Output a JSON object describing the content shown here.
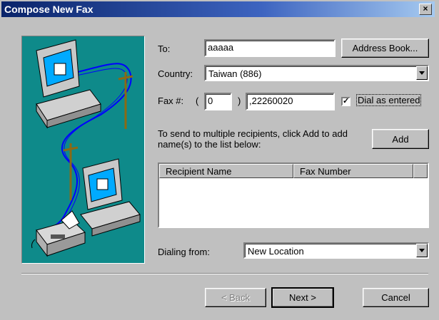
{
  "window": {
    "title": "Compose New Fax",
    "close_glyph": "×"
  },
  "to": {
    "label": "To:",
    "value": "aaaaa"
  },
  "address_book": {
    "label": "Address Book..."
  },
  "country": {
    "label": "Country:",
    "value": "Taiwan (886)"
  },
  "fax": {
    "label": "Fax #:",
    "open_paren": "(",
    "close_paren": ")",
    "area_code": "0",
    "number": ",22260020"
  },
  "dial_as_entered": {
    "label": "Dial as entered",
    "checked": true,
    "check_glyph": "✓"
  },
  "instruction": "To send to multiple recipients, click Add to add name(s) to the list below:",
  "add_button": {
    "label": "Add"
  },
  "recipients_table": {
    "columns": [
      "Recipient Name",
      "Fax Number"
    ],
    "rows": []
  },
  "dialing_from": {
    "label": "Dialing from:",
    "value": "New Location"
  },
  "buttons": {
    "back": "< Back",
    "next": "Next >",
    "cancel": "Cancel"
  },
  "colors": {
    "titlebar_start": "#0a246a",
    "titlebar_end": "#a6caf0",
    "illustration_bg": "#0e8a8a"
  }
}
